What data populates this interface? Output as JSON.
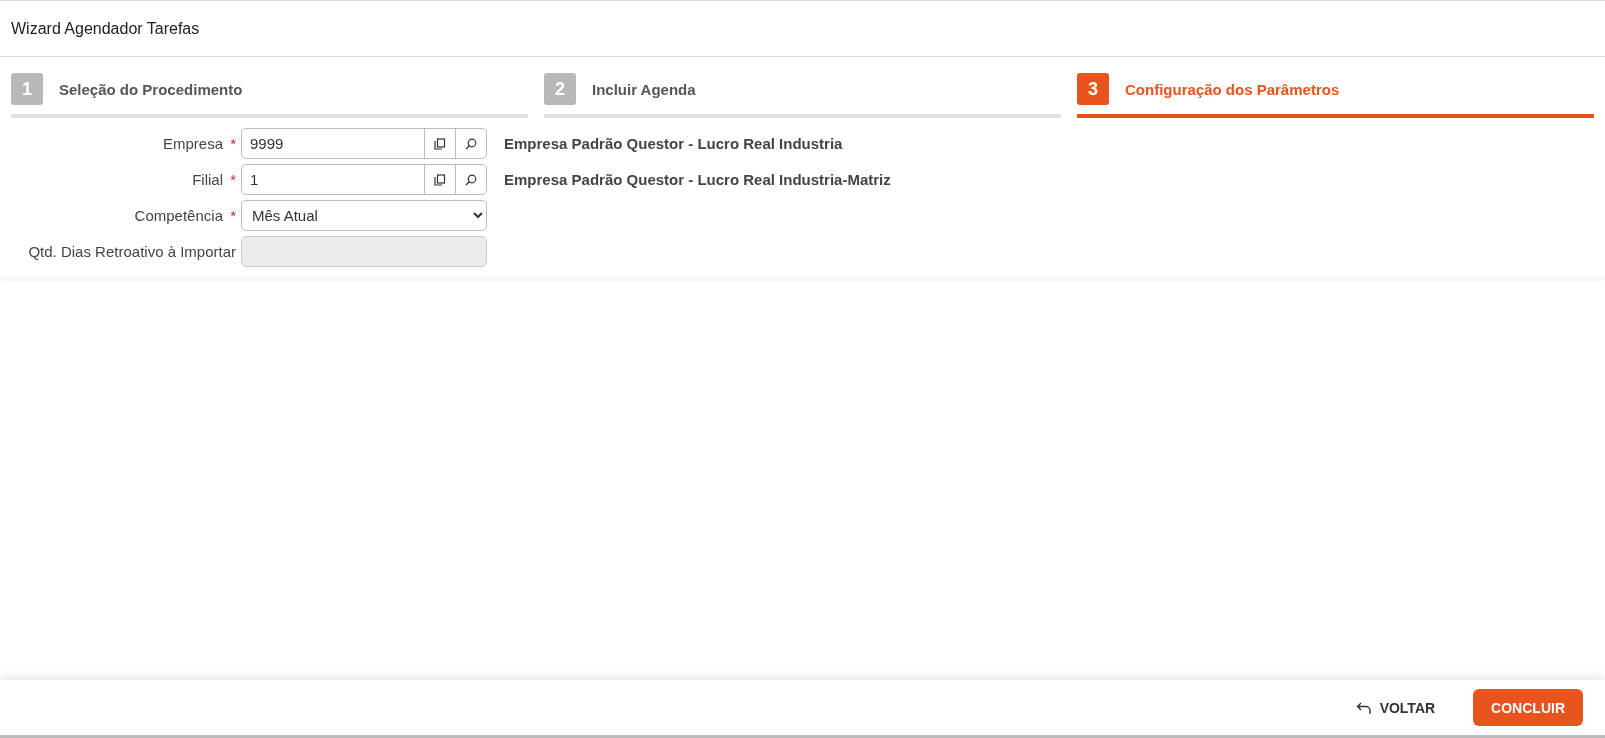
{
  "window": {
    "title": "Wizard Agendador Tarefas"
  },
  "steps": [
    {
      "number": "1",
      "label": "Seleção do Procedimento",
      "selected": false
    },
    {
      "number": "2",
      "label": "Incluir Agenda",
      "selected": false
    },
    {
      "number": "3",
      "label": "Configuração dos Parâmetros",
      "selected": true
    }
  ],
  "fields": [
    {
      "kind": "lookup",
      "label": "Empresa",
      "required": true,
      "value": "9999",
      "description": "Empresa Padrão Questor - Lucro Real Industria",
      "disabled": false
    },
    {
      "kind": "lookup",
      "label": "Filial",
      "required": true,
      "value": "1",
      "description": "Empresa Padrão Questor - Lucro Real Industria-Matriz",
      "disabled": false
    },
    {
      "kind": "select",
      "label": "Competência",
      "required": true,
      "value": "Mês Atual",
      "disabled": false
    },
    {
      "kind": "text",
      "label": "Qtd. Dias Retroativo à Importar",
      "required": false,
      "disabled": true
    }
  ],
  "required_mark": "*",
  "footer": {
    "back_button": "VOLTAR",
    "finish_button": "CONCLUIR"
  }
}
